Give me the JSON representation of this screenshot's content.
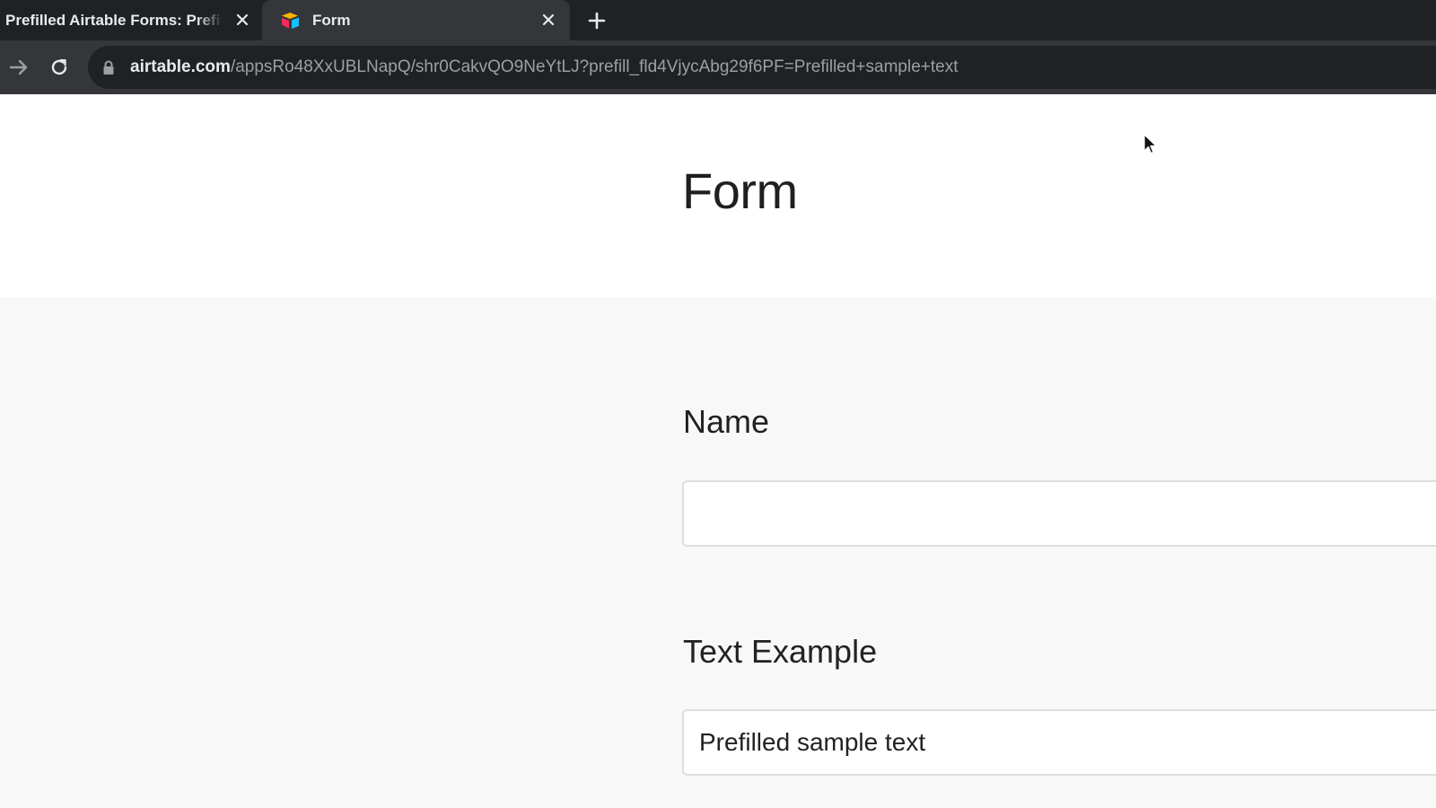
{
  "browser": {
    "tabs": [
      {
        "title": "Prefilled Airtable Forms: Prefill",
        "active": false
      },
      {
        "title": "Form",
        "active": true
      }
    ],
    "url_host": "airtable.com",
    "url_path": "/appsRo48XxUBLNapQ/shr0CakvQO9NeYtLJ?prefill_fld4VjycAbg29f6PF=Prefilled+sample+text"
  },
  "form": {
    "title": "Form",
    "fields": [
      {
        "label": "Name",
        "value": ""
      },
      {
        "label": "Text Example",
        "value": "Prefilled sample text"
      }
    ]
  },
  "icons": {
    "tab_close": "close-icon",
    "new_tab": "plus-icon",
    "forward": "arrow-right-icon",
    "reload": "reload-icon",
    "lock": "lock-icon",
    "favicon": "airtable-logo-icon",
    "cursor": "mouse-pointer-icon"
  },
  "colors": {
    "tabbar_bg": "#1f2123",
    "toolbar_bg": "#35363a",
    "omnibox_bg": "#202124",
    "page_bg": "#f8f8f8"
  }
}
